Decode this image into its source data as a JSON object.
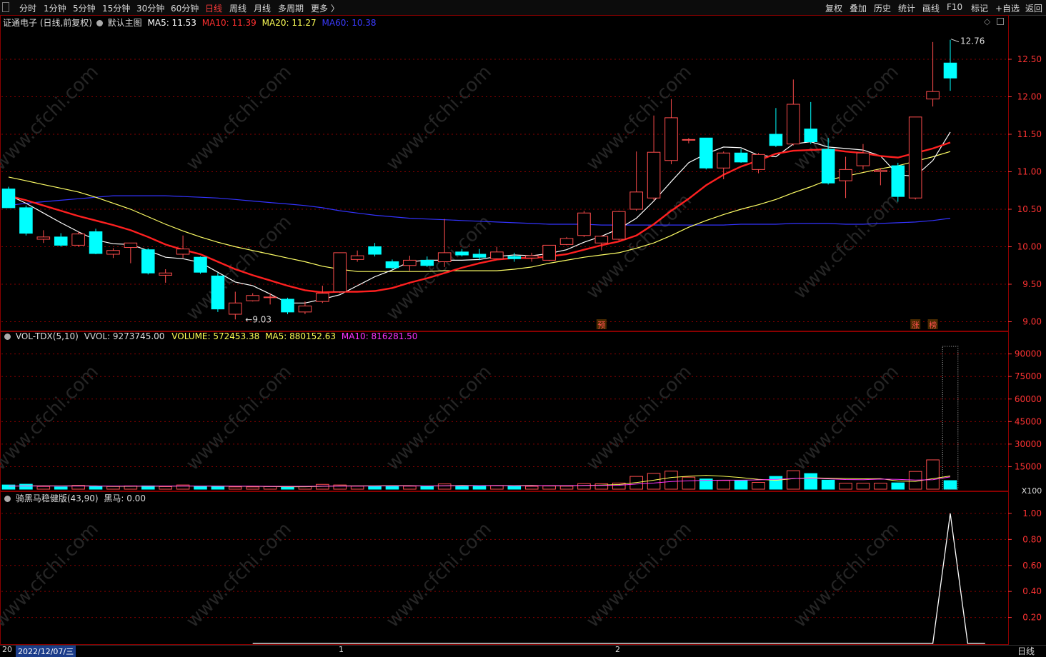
{
  "toolbar": {
    "icon": "grip-icon",
    "periods": [
      "分时",
      "1分钟",
      "5分钟",
      "15分钟",
      "30分钟",
      "60分钟",
      "日线",
      "周线",
      "月线",
      "多周期",
      "更多 〉"
    ],
    "active_period": "日线",
    "right_buttons": [
      "复权",
      "叠加",
      "历史",
      "统计",
      "画线",
      "F10",
      "标记",
      "+自选",
      "返回"
    ]
  },
  "main_info": {
    "stock": "证通电子 (日线,前复权)",
    "template": "默认主图",
    "ma5": "MA5: 11.53",
    "ma10": "MA10: 11.39",
    "ma20": "MA20: 11.27",
    "ma60": "MA60: 10.38"
  },
  "vol_info": {
    "name": "VOL-TDX(5,10)",
    "vvol": "VVOL: 9273745.00",
    "volume": "VOLUME: 572453.38",
    "ma5": "MA5: 880152.63",
    "ma10": "MA10: 816281.50"
  },
  "ind_info": {
    "name": "骑黑马稳健版(43,90)",
    "value": "黑马: 0.00"
  },
  "bottom": {
    "date": "2022/12/07/三",
    "left_mark": "20",
    "month_marks": [
      "1",
      "2"
    ],
    "period": "日线"
  },
  "colors": {
    "up": "#ff4d4d",
    "down": "#00ffff",
    "ma5": "#ffffff",
    "ma10": "#ff2020",
    "ma20": "#ffff66",
    "ma60": "#3333ff",
    "grid": "#8a0000",
    "axis_text": "#ff3333"
  },
  "chart_data": {
    "type": "candlestick",
    "title": "证通电子 (日线,前复权)",
    "price_ticks": [
      9.0,
      9.5,
      10.0,
      10.5,
      11.0,
      11.5,
      12.0,
      12.5
    ],
    "price_range": [
      8.9,
      12.9
    ],
    "high_annotation": "12.76",
    "low_annotation": "9.03",
    "markers": [
      {
        "index": 34,
        "text": "预"
      },
      {
        "index": 52,
        "text": "涨"
      },
      {
        "index": 53,
        "text": "榜"
      }
    ],
    "candles": [
      {
        "o": 10.77,
        "h": 10.8,
        "l": 10.52,
        "c": 10.52
      },
      {
        "o": 10.52,
        "h": 10.55,
        "l": 10.15,
        "c": 10.18
      },
      {
        "o": 10.1,
        "h": 10.22,
        "l": 10.05,
        "c": 10.13
      },
      {
        "o": 10.13,
        "h": 10.18,
        "l": 10.0,
        "c": 10.02
      },
      {
        "o": 10.02,
        "h": 10.2,
        "l": 10.0,
        "c": 10.17
      },
      {
        "o": 10.2,
        "h": 10.24,
        "l": 9.9,
        "c": 9.91
      },
      {
        "o": 9.9,
        "h": 9.98,
        "l": 9.85,
        "c": 9.95
      },
      {
        "o": 9.99,
        "h": 10.05,
        "l": 9.78,
        "c": 10.05
      },
      {
        "o": 9.96,
        "h": 9.98,
        "l": 9.63,
        "c": 9.65
      },
      {
        "o": 9.62,
        "h": 9.7,
        "l": 9.52,
        "c": 9.65
      },
      {
        "o": 9.9,
        "h": 10.15,
        "l": 9.85,
        "c": 9.97
      },
      {
        "o": 9.86,
        "h": 9.87,
        "l": 9.64,
        "c": 9.66
      },
      {
        "o": 9.61,
        "h": 9.65,
        "l": 9.13,
        "c": 9.17
      },
      {
        "o": 9.1,
        "h": 9.4,
        "l": 9.03,
        "c": 9.25
      },
      {
        "o": 9.28,
        "h": 9.38,
        "l": 9.27,
        "c": 9.35
      },
      {
        "o": 9.33,
        "h": 9.38,
        "l": 9.23,
        "c": 9.33
      },
      {
        "o": 9.3,
        "h": 9.32,
        "l": 9.1,
        "c": 9.13
      },
      {
        "o": 9.13,
        "h": 9.27,
        "l": 9.1,
        "c": 9.21
      },
      {
        "o": 9.27,
        "h": 9.48,
        "l": 9.25,
        "c": 9.38
      },
      {
        "o": 9.4,
        "h": 9.92,
        "l": 9.38,
        "c": 9.92
      },
      {
        "o": 9.83,
        "h": 9.95,
        "l": 9.8,
        "c": 9.88
      },
      {
        "o": 10.0,
        "h": 10.05,
        "l": 9.87,
        "c": 9.9
      },
      {
        "o": 9.8,
        "h": 9.83,
        "l": 9.7,
        "c": 9.72
      },
      {
        "o": 9.75,
        "h": 9.88,
        "l": 9.68,
        "c": 9.82
      },
      {
        "o": 9.82,
        "h": 9.87,
        "l": 9.73,
        "c": 9.75
      },
      {
        "o": 9.8,
        "h": 10.37,
        "l": 9.73,
        "c": 9.92
      },
      {
        "o": 9.93,
        "h": 9.97,
        "l": 9.87,
        "c": 9.89
      },
      {
        "o": 9.9,
        "h": 9.97,
        "l": 9.82,
        "c": 9.86
      },
      {
        "o": 9.84,
        "h": 10.0,
        "l": 9.83,
        "c": 9.93
      },
      {
        "o": 9.87,
        "h": 9.92,
        "l": 9.8,
        "c": 9.84
      },
      {
        "o": 9.85,
        "h": 9.92,
        "l": 9.8,
        "c": 9.88
      },
      {
        "o": 9.82,
        "h": 10.02,
        "l": 9.81,
        "c": 10.02
      },
      {
        "o": 10.03,
        "h": 10.13,
        "l": 10.02,
        "c": 10.11
      },
      {
        "o": 10.15,
        "h": 10.48,
        "l": 10.13,
        "c": 10.45
      },
      {
        "o": 10.05,
        "h": 10.15,
        "l": 9.95,
        "c": 10.14
      },
      {
        "o": 10.1,
        "h": 10.48,
        "l": 10.08,
        "c": 10.47
      },
      {
        "o": 10.5,
        "h": 11.27,
        "l": 10.48,
        "c": 10.73
      },
      {
        "o": 10.65,
        "h": 11.75,
        "l": 10.62,
        "c": 11.26
      },
      {
        "o": 11.15,
        "h": 11.97,
        "l": 11.1,
        "c": 11.72
      },
      {
        "o": 11.43,
        "h": 11.45,
        "l": 11.38,
        "c": 11.43
      },
      {
        "o": 11.45,
        "h": 11.45,
        "l": 11.03,
        "c": 11.05
      },
      {
        "o": 11.05,
        "h": 11.27,
        "l": 10.9,
        "c": 11.25
      },
      {
        "o": 11.25,
        "h": 11.3,
        "l": 11.12,
        "c": 11.13
      },
      {
        "o": 11.03,
        "h": 11.25,
        "l": 10.98,
        "c": 11.23
      },
      {
        "o": 11.5,
        "h": 11.85,
        "l": 11.33,
        "c": 11.35
      },
      {
        "o": 11.37,
        "h": 12.23,
        "l": 11.35,
        "c": 11.9
      },
      {
        "o": 11.57,
        "h": 11.93,
        "l": 11.37,
        "c": 11.4
      },
      {
        "o": 11.3,
        "h": 11.45,
        "l": 10.83,
        "c": 10.85
      },
      {
        "o": 10.88,
        "h": 11.2,
        "l": 10.65,
        "c": 11.03
      },
      {
        "o": 11.08,
        "h": 11.37,
        "l": 11.03,
        "c": 11.25
      },
      {
        "o": 11.0,
        "h": 11.05,
        "l": 10.82,
        "c": 11.02
      },
      {
        "o": 11.08,
        "h": 11.12,
        "l": 10.6,
        "c": 10.67
      },
      {
        "o": 10.65,
        "h": 11.73,
        "l": 10.63,
        "c": 11.73
      },
      {
        "o": 11.97,
        "h": 12.73,
        "l": 11.87,
        "c": 12.07
      },
      {
        "o": 12.45,
        "h": 12.76,
        "l": 12.08,
        "c": 12.25
      }
    ],
    "ma5": [
      10.69,
      10.58,
      10.45,
      10.32,
      10.2,
      10.09,
      10.04,
      10.03,
      9.95,
      9.86,
      9.84,
      9.79,
      9.66,
      9.53,
      9.48,
      9.37,
      9.25,
      9.25,
      9.3,
      9.36,
      9.48,
      9.6,
      9.69,
      9.8,
      9.82,
      9.82,
      9.82,
      9.83,
      9.87,
      9.89,
      9.88,
      9.91,
      9.96,
      10.06,
      10.14,
      10.24,
      10.38,
      10.61,
      10.87,
      11.12,
      11.24,
      11.33,
      11.32,
      11.22,
      11.2,
      11.37,
      11.4,
      11.33,
      11.31,
      11.29,
      11.21,
      10.96,
      10.94,
      11.15,
      11.53
    ],
    "ma10": [
      10.68,
      10.62,
      10.55,
      10.48,
      10.41,
      10.35,
      10.29,
      10.22,
      10.13,
      10.03,
      9.96,
      9.9,
      9.8,
      9.7,
      9.62,
      9.55,
      9.48,
      9.42,
      9.39,
      9.4,
      9.4,
      9.41,
      9.45,
      9.52,
      9.58,
      9.65,
      9.72,
      9.78,
      9.83,
      9.85,
      9.85,
      9.87,
      9.9,
      9.96,
      10.02,
      10.07,
      10.15,
      10.3,
      10.48,
      10.64,
      10.82,
      10.96,
      11.07,
      11.15,
      11.24,
      11.28,
      11.29,
      11.3,
      11.27,
      11.25,
      11.21,
      11.19,
      11.25,
      11.31,
      11.39
    ],
    "ma20": [
      10.93,
      10.88,
      10.83,
      10.78,
      10.73,
      10.66,
      10.58,
      10.5,
      10.4,
      10.3,
      10.21,
      10.13,
      10.06,
      10.0,
      9.95,
      9.9,
      9.85,
      9.8,
      9.74,
      9.7,
      9.67,
      9.67,
      9.67,
      9.67,
      9.67,
      9.68,
      9.68,
      9.68,
      9.68,
      9.7,
      9.73,
      9.78,
      9.82,
      9.86,
      9.89,
      9.92,
      9.98,
      10.05,
      10.15,
      10.26,
      10.35,
      10.43,
      10.5,
      10.56,
      10.63,
      10.72,
      10.8,
      10.89,
      10.94,
      10.99,
      11.04,
      11.08,
      11.14,
      11.2,
      11.27
    ],
    "ma60": [
      10.55,
      10.58,
      10.6,
      10.62,
      10.64,
      10.66,
      10.68,
      10.68,
      10.68,
      10.68,
      10.67,
      10.66,
      10.65,
      10.63,
      10.61,
      10.59,
      10.57,
      10.55,
      10.52,
      10.48,
      10.45,
      10.42,
      10.4,
      10.38,
      10.37,
      10.36,
      10.35,
      10.34,
      10.33,
      10.32,
      10.31,
      10.3,
      10.3,
      10.3,
      10.29,
      10.29,
      10.29,
      10.29,
      10.29,
      10.29,
      10.29,
      10.29,
      10.3,
      10.3,
      10.3,
      10.31,
      10.31,
      10.31,
      10.3,
      10.3,
      10.31,
      10.32,
      10.33,
      10.35,
      10.38
    ],
    "vol_ticks": [
      15000,
      30000,
      45000,
      60000,
      75000,
      90000
    ],
    "vol_range": [
      0,
      96000
    ],
    "vol_unit": "X100",
    "volume": [
      2800,
      3300,
      1800,
      1500,
      2500,
      2000,
      1800,
      2200,
      2200,
      1700,
      2800,
      1800,
      1800,
      1500,
      1500,
      1700,
      1700,
      1800,
      3200,
      2800,
      2000,
      1800,
      1900,
      2000,
      1900,
      3500,
      2200,
      2200,
      2300,
      1900,
      1900,
      2100,
      2000,
      3700,
      3600,
      4100,
      8500,
      10500,
      12000,
      8000,
      6800,
      5800,
      5800,
      4500,
      8500,
      12300,
      10400,
      6000,
      4000,
      4000,
      4000,
      4200,
      11800,
      19500,
      5700
    ],
    "vol_ma5": [
      2000,
      2200,
      2300,
      2200,
      2300,
      2200,
      1900,
      1900,
      2100,
      2000,
      2100,
      2100,
      2100,
      1900,
      1900,
      1700,
      1600,
      1600,
      1900,
      2200,
      2300,
      2300,
      2400,
      2400,
      2100,
      2300,
      2500,
      2400,
      2500,
      2400,
      2500,
      2300,
      2200,
      2500,
      2700,
      3100,
      4400,
      6000,
      7800,
      8600,
      9200,
      8600,
      7700,
      6500,
      5900,
      7000,
      7600,
      7300,
      7100,
      6900,
      7000,
      5400,
      5200,
      7000,
      8800
    ],
    "vol_ma10": [
      2100,
      2100,
      2100,
      2100,
      2100,
      2100,
      2100,
      2100,
      2100,
      2100,
      2100,
      2100,
      2000,
      2000,
      2000,
      1900,
      1900,
      1900,
      2000,
      2000,
      2100,
      2100,
      2200,
      2200,
      2200,
      2300,
      2300,
      2400,
      2400,
      2300,
      2300,
      2400,
      2400,
      2500,
      2500,
      2600,
      3400,
      4100,
      5100,
      5600,
      5900,
      6000,
      6000,
      6200,
      6500,
      7100,
      7300,
      6900,
      6400,
      6300,
      6700,
      6500,
      6100,
      6300,
      8200
    ],
    "horse_ticks": [
      0.2,
      0.4,
      0.6,
      0.8,
      1.0
    ],
    "horse_range": [
      0,
      1.06
    ],
    "horse_start_index": 14,
    "horse": [
      0,
      0,
      0,
      0,
      0,
      0,
      0,
      0,
      0,
      0,
      0,
      0,
      0,
      0,
      0,
      0,
      0,
      0,
      0,
      0,
      0,
      0,
      0,
      0,
      0,
      0,
      0,
      0,
      0,
      0,
      0,
      0,
      0,
      0,
      0,
      0,
      0,
      0,
      0,
      0,
      1.0,
      0,
      0
    ]
  }
}
